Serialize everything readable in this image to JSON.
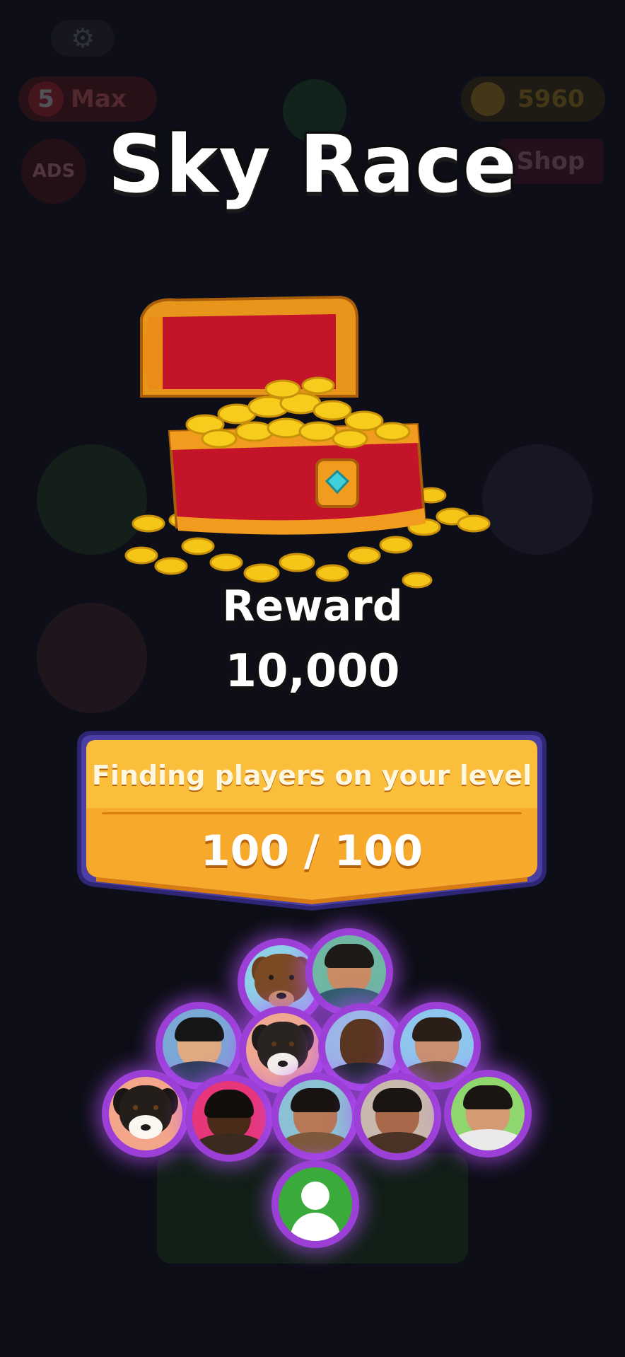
{
  "background": {
    "lives": {
      "count": "5",
      "label": "Max"
    },
    "coins": "5960",
    "ads_label": "ADS",
    "shop_label": "Shop"
  },
  "modal": {
    "title": "Sky Race",
    "reward_label": "Reward",
    "reward_value": "10,000",
    "status_text": "Finding players on your level",
    "progress_text": "100 / 100",
    "progress_fraction": 1.0
  },
  "players": [
    {
      "kind": "bear"
    },
    {
      "kind": "man"
    },
    {
      "kind": "man"
    },
    {
      "kind": "dog"
    },
    {
      "kind": "man"
    },
    {
      "kind": "man"
    },
    {
      "kind": "dog"
    },
    {
      "kind": "man"
    },
    {
      "kind": "man"
    },
    {
      "kind": "man"
    },
    {
      "kind": "man"
    },
    {
      "kind": "you"
    }
  ],
  "colors": {
    "banner": "#f7a92b",
    "avatar_ring": "#9b3fd6",
    "you_avatar": "#3aaa3a"
  }
}
